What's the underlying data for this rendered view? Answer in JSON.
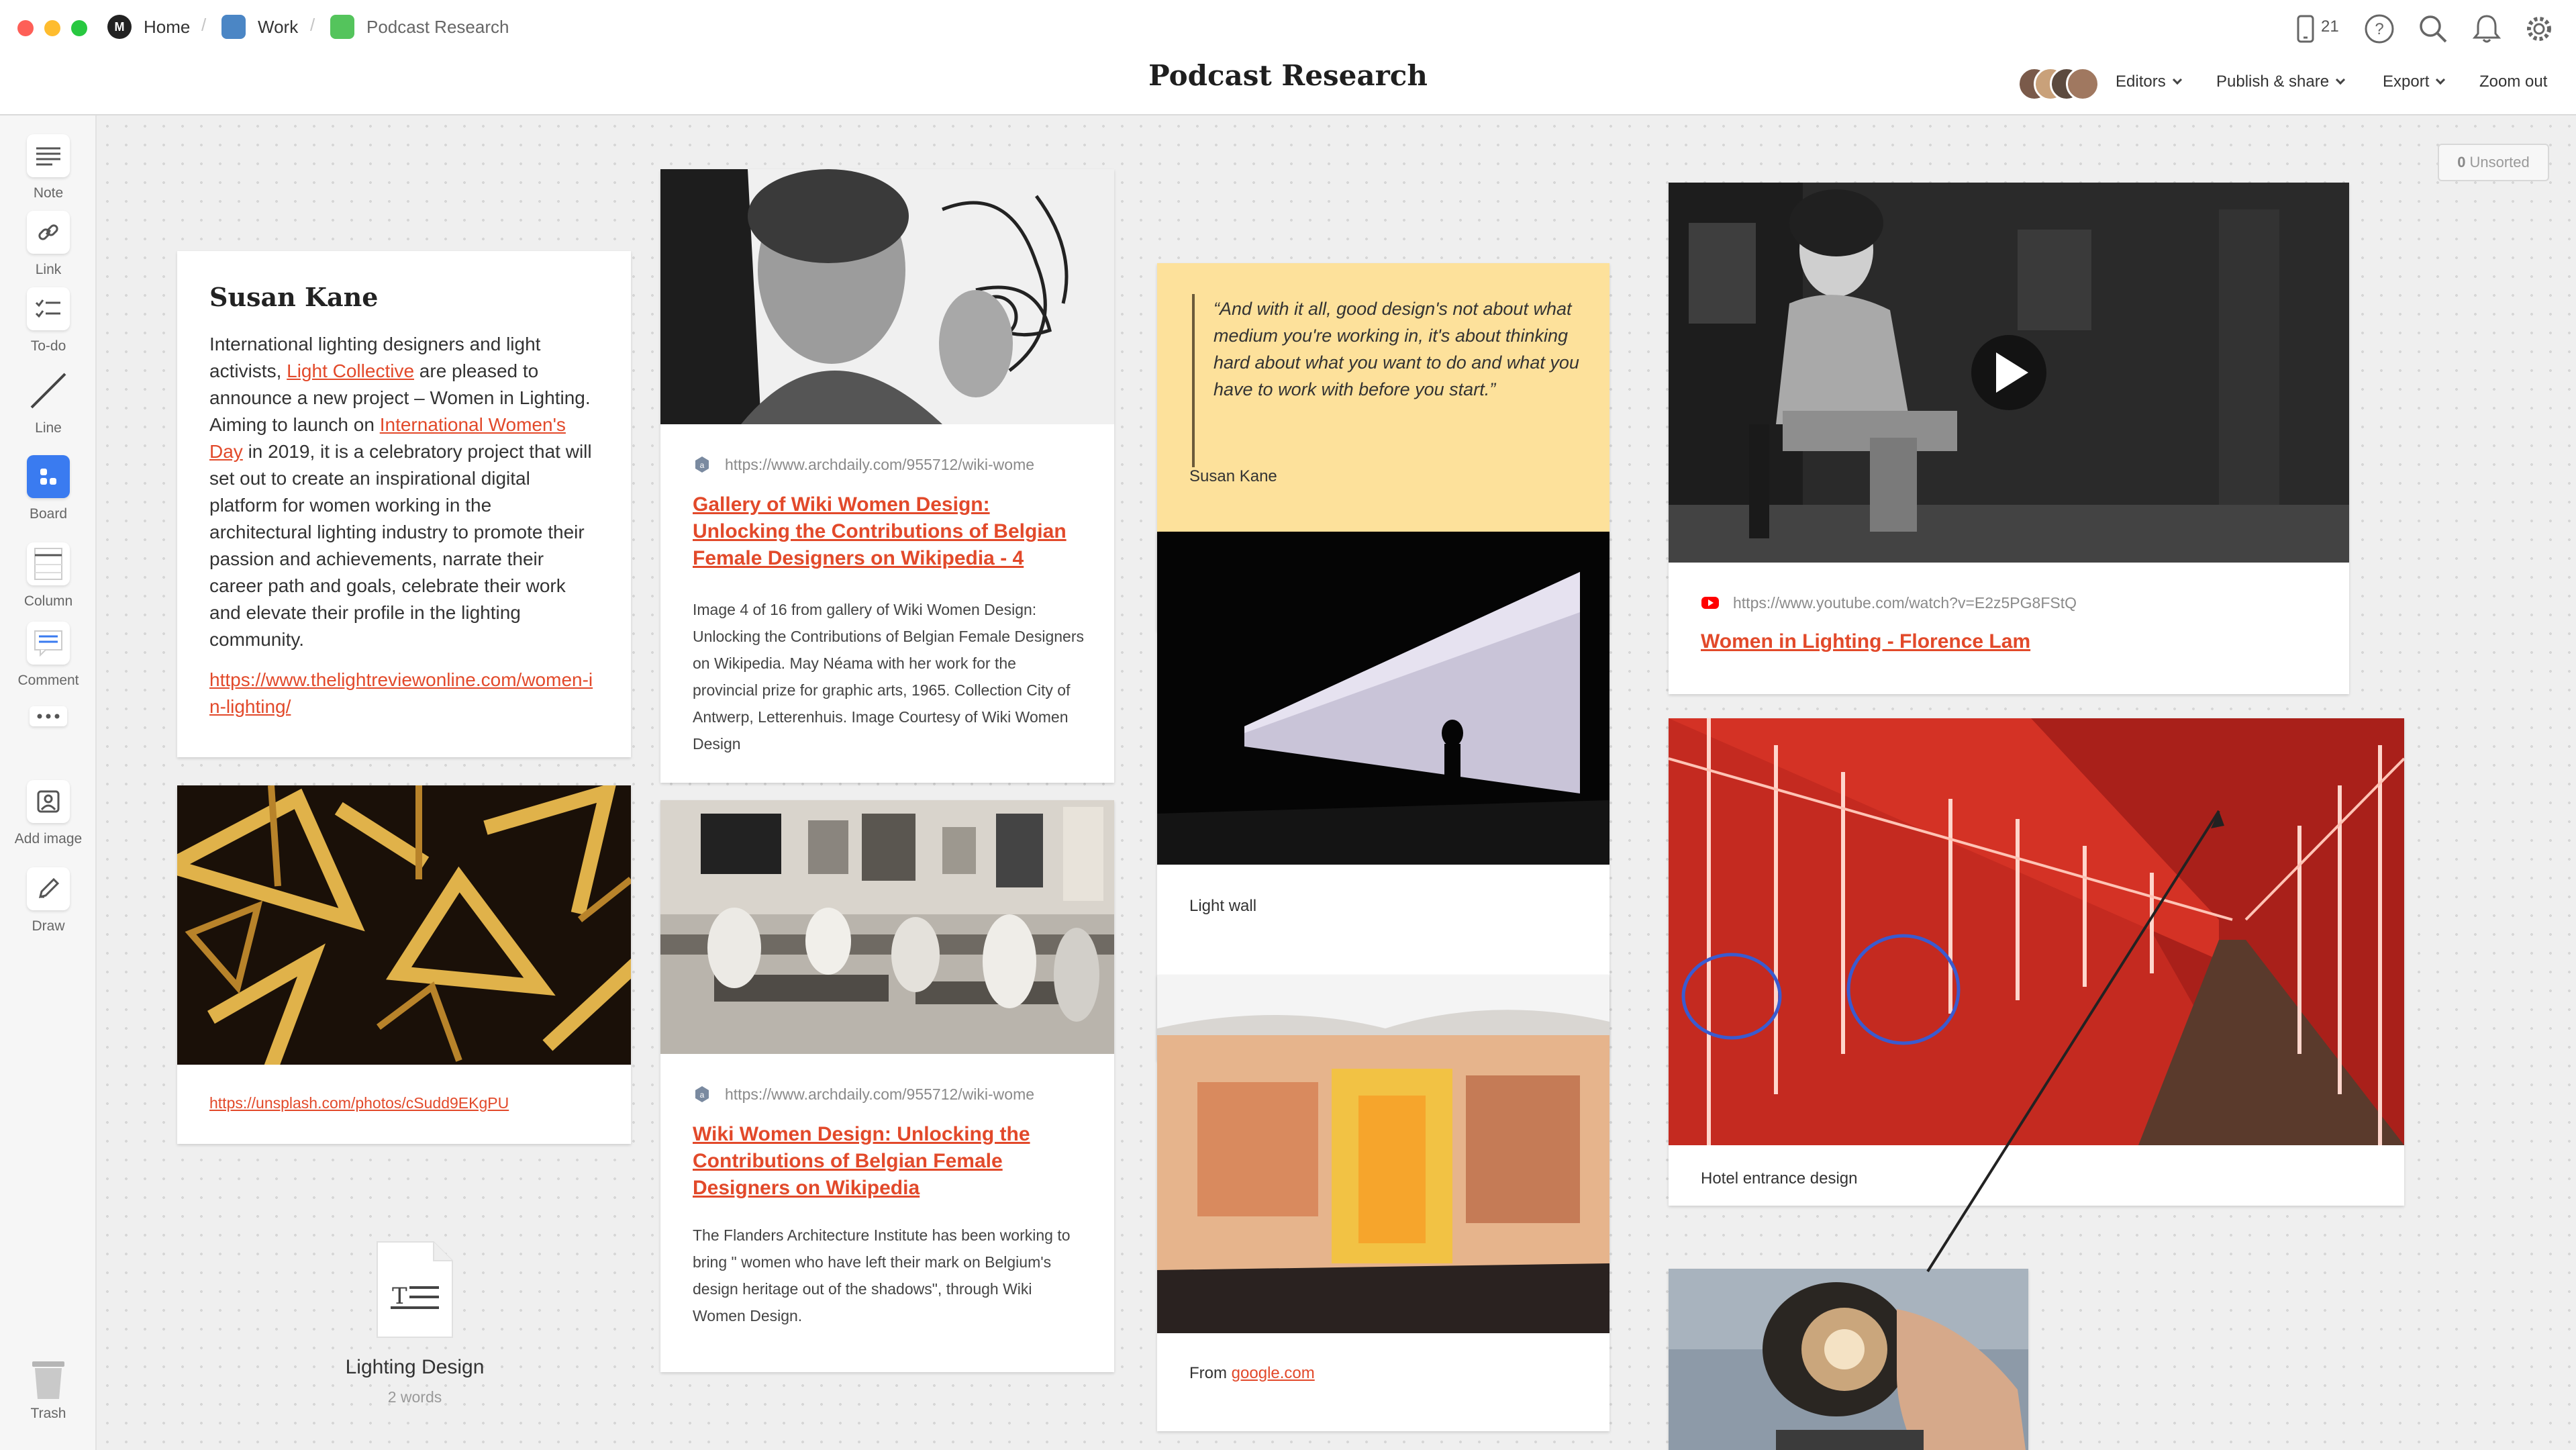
{
  "window": {
    "breadcrumbs": [
      {
        "label": "Home"
      },
      {
        "label": "Work"
      },
      {
        "label": "Podcast Research"
      }
    ],
    "title": "Podcast Research"
  },
  "header": {
    "device_count": "21",
    "menu": {
      "editors": "Editors",
      "publish": "Publish & share",
      "export": "Export",
      "zoom": "Zoom out"
    }
  },
  "toolbar": {
    "items": [
      {
        "label": "Note",
        "icon": "note-icon"
      },
      {
        "label": "Link",
        "icon": "link-icon"
      },
      {
        "label": "To-do",
        "icon": "todo-icon"
      },
      {
        "label": "Line",
        "icon": "line-icon"
      },
      {
        "label": "Board",
        "icon": "board-icon"
      },
      {
        "label": "Column",
        "icon": "column-icon"
      },
      {
        "label": "Comment",
        "icon": "comment-icon"
      },
      {
        "label": "Add image",
        "icon": "add-image-icon"
      },
      {
        "label": "Draw",
        "icon": "draw-icon"
      },
      {
        "label": "Trash",
        "icon": "trash-icon"
      }
    ]
  },
  "canvas": {
    "unsorted_count": "0",
    "unsorted_label": "Unsorted",
    "note": {
      "title": "Susan Kane",
      "text_1": "International lighting designers and light activists, ",
      "link_1": "Light Collective",
      "text_2": " are pleased to announce a new project – Women in Lighting.  Aiming to launch on ",
      "link_2": "International Women's Day",
      "text_3": " in 2019, it is a celebratory project that will set out to create an inspirational digital platform for women working in the architectural lighting industry to promote their passion and achievements, narrate their career path and goals, celebrate their work and elevate their profile in the lighting community.",
      "url": "https://www.thelightreviewonline.com/women-in-lighting/"
    },
    "unsplash_card": {
      "url": "https://unsplash.com/photos/cSudd9EKgPU"
    },
    "doc": {
      "title": "Lighting Design",
      "words": "2 words"
    },
    "archdaily_1": {
      "url": "https://www.archdaily.com/955712/wiki-wome",
      "title": "Gallery of Wiki Women Design: Unlocking the Contributions of Belgian Female Designers on Wikipedia - 4",
      "description": "Image 4 of 16 from gallery of Wiki Women Design: Unlocking the Contributions of Belgian Female Designers on Wikipedia. May Néama with her work for the provincial prize for graphic arts, 1965. Collection City of Antwerp, Letterenhuis. Image Courtesy of Wiki Women Design"
    },
    "archdaily_2": {
      "url": "https://www.archdaily.com/955712/wiki-wome",
      "title": "Wiki Women Design: Unlocking the Contributions of Belgian Female Designers on Wikipedia",
      "description": "The Flanders Architecture Institute has been working to bring \" women who have left their mark on Belgium's design heritage out of the shadows\", through Wiki Women Design."
    },
    "quote": {
      "text": "“And with it all, good design's not about what medium you're working in, it's about thinking hard about what you want to do and what you have to work with before you start.”",
      "author": "Susan Kane"
    },
    "light_wall": {
      "caption": "Light wall"
    },
    "google_card": {
      "prefix": "From ",
      "link": "google.com"
    },
    "youtube": {
      "url": "https://www.youtube.com/watch?v=E2z5PG8FStQ",
      "title": "Women in Lighting - Florence Lam"
    },
    "hotel": {
      "caption": "Hotel entrance design"
    }
  }
}
